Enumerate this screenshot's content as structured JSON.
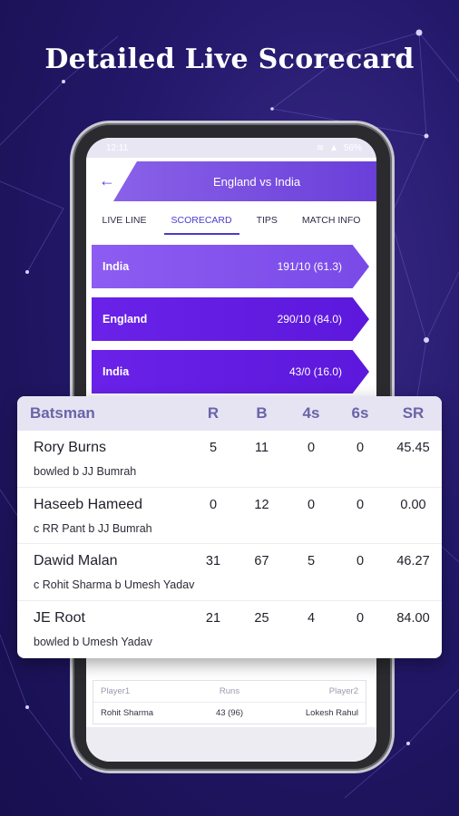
{
  "headline": "Detailed Live Scorecard",
  "status_bar": {
    "time": "12:11",
    "battery": "56%"
  },
  "header": {
    "back_icon": "arrow-left-icon",
    "title": "England vs India"
  },
  "tabs": [
    {
      "label": "LIVE LINE",
      "active": false
    },
    {
      "label": "SCORECARD",
      "active": true
    },
    {
      "label": "TIPS",
      "active": false
    },
    {
      "label": "MATCH INFO",
      "active": false
    }
  ],
  "innings": [
    {
      "team": "India",
      "score": "191/10 (61.3)"
    },
    {
      "team": "England",
      "score": "290/10 (84.0)"
    },
    {
      "team": "India",
      "score": "43/0 (16.0)"
    }
  ],
  "batting_card": {
    "headers": {
      "batsman": "Batsman",
      "r": "R",
      "b": "B",
      "fours": "4s",
      "sixes": "6s",
      "sr": "SR"
    },
    "rows": [
      {
        "name": "Rory Burns",
        "dismissal": "bowled b JJ Bumrah",
        "r": "5",
        "b": "11",
        "fours": "0",
        "sixes": "0",
        "sr": "45.45"
      },
      {
        "name": "Haseeb Hameed",
        "dismissal": "c RR Pant b JJ Bumrah",
        "r": "0",
        "b": "12",
        "fours": "0",
        "sixes": "0",
        "sr": "0.00"
      },
      {
        "name": "Dawid Malan",
        "dismissal": "c Rohit Sharma b Umesh Yadav",
        "r": "31",
        "b": "67",
        "fours": "5",
        "sixes": "0",
        "sr": "46.27"
      },
      {
        "name": "JE Root",
        "dismissal": "bowled b Umesh Yadav",
        "r": "21",
        "b": "25",
        "fours": "4",
        "sixes": "0",
        "sr": "84.00"
      }
    ]
  },
  "partnership": {
    "headers": {
      "player1": "Player1",
      "runs": "Runs",
      "player2": "Player2"
    },
    "row": {
      "player1": "Rohit Sharma",
      "runs": "43 (96)",
      "player2": "Lokesh Rahul"
    }
  },
  "colors": {
    "accent": "#6a3fd9",
    "background": "#23186a",
    "card_header": "#e6e4f3"
  }
}
